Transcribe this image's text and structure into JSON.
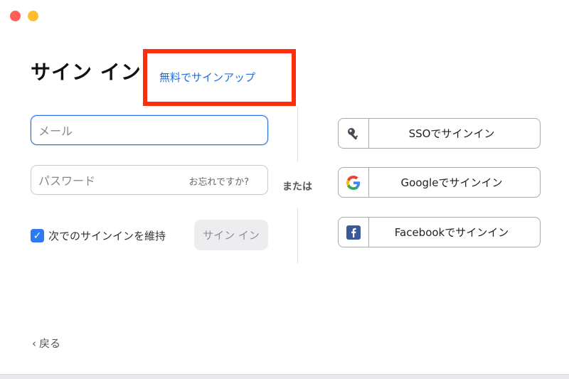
{
  "window": {
    "buttons": [
      "close",
      "minimize"
    ]
  },
  "header": {
    "title": "サイン イン",
    "signup_link": "無料でサインアップ"
  },
  "form": {
    "email_placeholder": "メール",
    "password_placeholder": "パスワード",
    "forgot_link": "お忘れですか?",
    "remember_label": "次でのサインインを維持",
    "remember_checked": true,
    "signin_button": "サイン イン"
  },
  "or_label": "または",
  "sso": {
    "key_label": "SSOでサインイン",
    "google_label": "Googleでサインイン",
    "facebook_label": "Facebookでサインイン"
  },
  "back_label": "戻る",
  "colors": {
    "accent": "#2a7bf4",
    "link": "#1f6fe0",
    "highlight_box": "#ff2d0e",
    "close": "#fe5f57",
    "minimize": "#febc2e"
  },
  "icons": [
    "key-icon",
    "google-icon",
    "facebook-icon",
    "chevron-left-icon",
    "checkmark-icon"
  ]
}
